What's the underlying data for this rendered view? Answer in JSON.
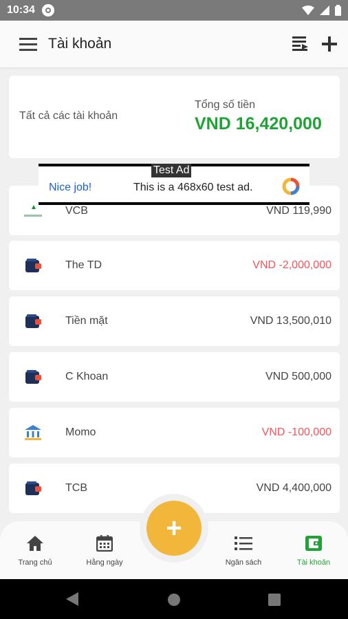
{
  "status": {
    "time": "10:34"
  },
  "app_bar": {
    "title": "Tài khoản"
  },
  "summary": {
    "all_accounts_label": "Tất cả các tài khoản",
    "total_label": "Tổng số tiền",
    "total_value": "VND 16,420,000"
  },
  "ad": {
    "badge": "Test Ad",
    "headline": "Nice job!",
    "body": "This is a 468x60 test ad."
  },
  "accounts": [
    {
      "name": "VCB",
      "balance": "VND 119,990",
      "icon": "bank-logo-icon",
      "negative": false
    },
    {
      "name": "The TD",
      "balance": "VND -2,000,000",
      "icon": "wallet-icon",
      "negative": true
    },
    {
      "name": "Tiền mặt",
      "balance": "VND 13,500,010",
      "icon": "wallet-icon",
      "negative": false
    },
    {
      "name": "C Khoan",
      "balance": "VND 500,000",
      "icon": "wallet-icon",
      "negative": false
    },
    {
      "name": "Momo",
      "balance": "VND -100,000",
      "icon": "bank-building-icon",
      "negative": true
    },
    {
      "name": "TCB",
      "balance": "VND 4,400,000",
      "icon": "wallet-icon",
      "negative": false
    }
  ],
  "bottom_nav": {
    "home": "Trang chủ",
    "daily": "Hằng ngày",
    "budget": "Ngân sách",
    "accounts": "Tài khoản",
    "fab": "+"
  },
  "colors": {
    "accent_green": "#1fa335",
    "negative_red": "#f2545b",
    "fab_yellow": "#f2b73a"
  }
}
